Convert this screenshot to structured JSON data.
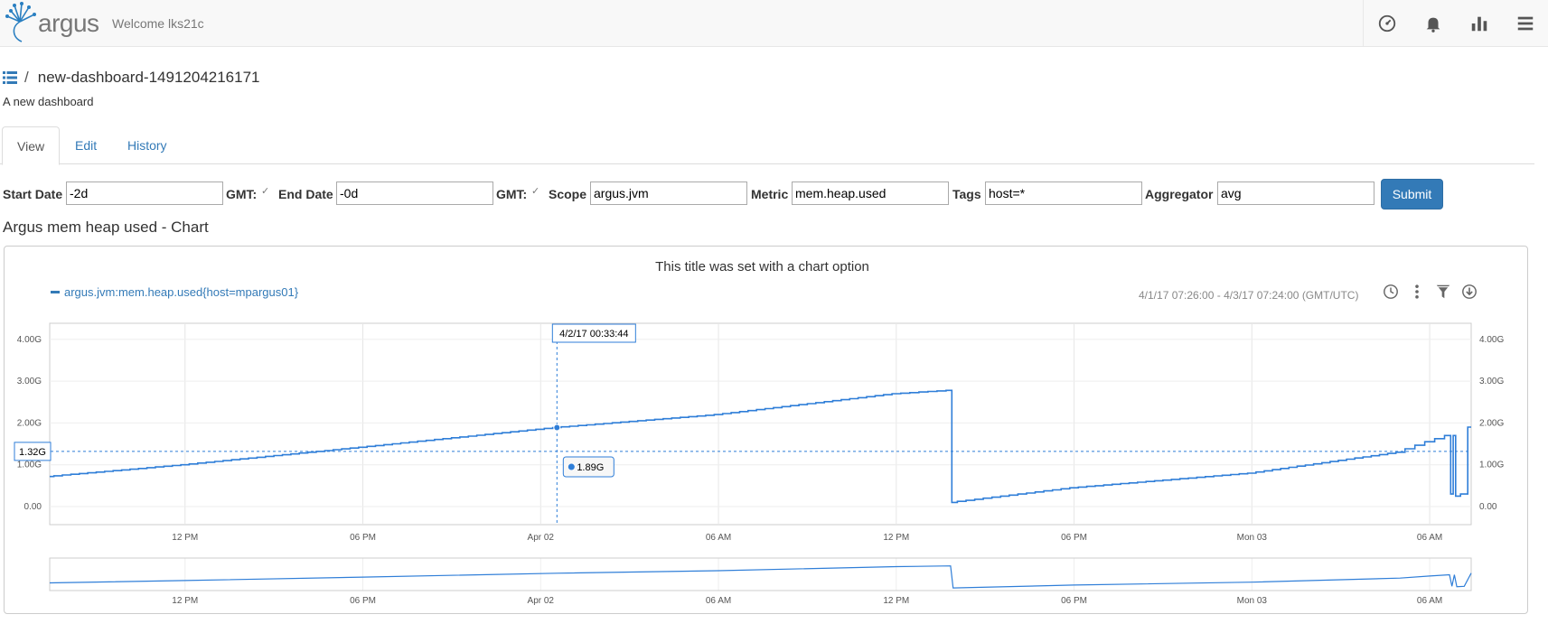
{
  "header": {
    "logo_text": "argus",
    "welcome": "Welcome lks21c"
  },
  "nav_icons": [
    "dashboard-gauge-icon",
    "bell-icon",
    "bar-chart-icon",
    "hamburger-menu-icon"
  ],
  "page": {
    "title": "new-dashboard-1491204216171",
    "breadcrumb_separator": "/",
    "description": "A new dashboard"
  },
  "tabs": [
    {
      "label": "View",
      "active": true
    },
    {
      "label": "Edit",
      "active": false
    },
    {
      "label": "History",
      "active": false
    }
  ],
  "form": {
    "start_label": "Start Date",
    "start_value": "-2d",
    "gmt_label": "GMT:",
    "end_label": "End Date",
    "end_value": "-0d",
    "gmt2_label": "GMT:",
    "scope_label": "Scope",
    "scope_value": "argus.jvm",
    "metric_label": "Metric",
    "metric_value": "mem.heap.used",
    "tags_label": "Tags",
    "tags_value": "host=*",
    "aggregator_label": "Aggregator",
    "aggregator_value": "avg",
    "submit_label": "Submit"
  },
  "chart_heading": "Argus mem heap used - Chart",
  "chart_panel": {
    "title": "This title was set with a chart option",
    "date_range": "4/1/17 07:26:00 - 4/3/17 07:24:00 (GMT/UTC)",
    "tool_icons": [
      "clock-icon",
      "more-vertical-icon",
      "filter-icon",
      "download-icon"
    ],
    "hover_time": "4/2/17 00:33:44",
    "hover_value": "1.89G",
    "crosshair_value": "1.32G"
  },
  "chart_data": {
    "type": "line",
    "title": "This title was set with a chart option",
    "series": [
      {
        "name": "argus.jvm:mem.heap.used{host=mpargus01}",
        "color": "#2f7ed8",
        "points": [
          [
            "2017-04-01 07:26",
            0.72
          ],
          [
            "2017-04-01 12:00",
            1.0
          ],
          [
            "2017-04-01 18:00",
            1.42
          ],
          [
            "2017-04-02 00:33",
            1.89
          ],
          [
            "2017-04-02 06:00",
            2.2
          ],
          [
            "2017-04-02 12:00",
            2.7
          ],
          [
            "2017-04-02 13:50",
            2.78
          ],
          [
            "2017-04-02 13:55",
            0.1
          ],
          [
            "2017-04-02 18:00",
            0.45
          ],
          [
            "2017-04-03 00:00",
            0.8
          ],
          [
            "2017-04-03 05:00",
            1.3
          ],
          [
            "2017-04-03 06:00",
            1.55
          ],
          [
            "2017-04-03 06:40",
            1.7
          ],
          [
            "2017-04-03 06:45",
            0.3
          ],
          [
            "2017-04-03 06:50",
            1.7
          ],
          [
            "2017-04-03 06:55",
            0.25
          ],
          [
            "2017-04-03 07:10",
            0.3
          ],
          [
            "2017-04-03 07:24",
            1.9
          ]
        ]
      }
    ],
    "x_ticks": [
      "12 PM",
      "06 PM",
      "Apr 02",
      "06 AM",
      "12 PM",
      "06 PM",
      "Mon 03",
      "06 AM"
    ],
    "y_ticks": [
      "0.00",
      "1.00G",
      "2.00G",
      "3.00G",
      "4.00G"
    ],
    "ylim": [
      0,
      4.4
    ],
    "grid": true,
    "legend": "top-left",
    "navigator": true
  }
}
